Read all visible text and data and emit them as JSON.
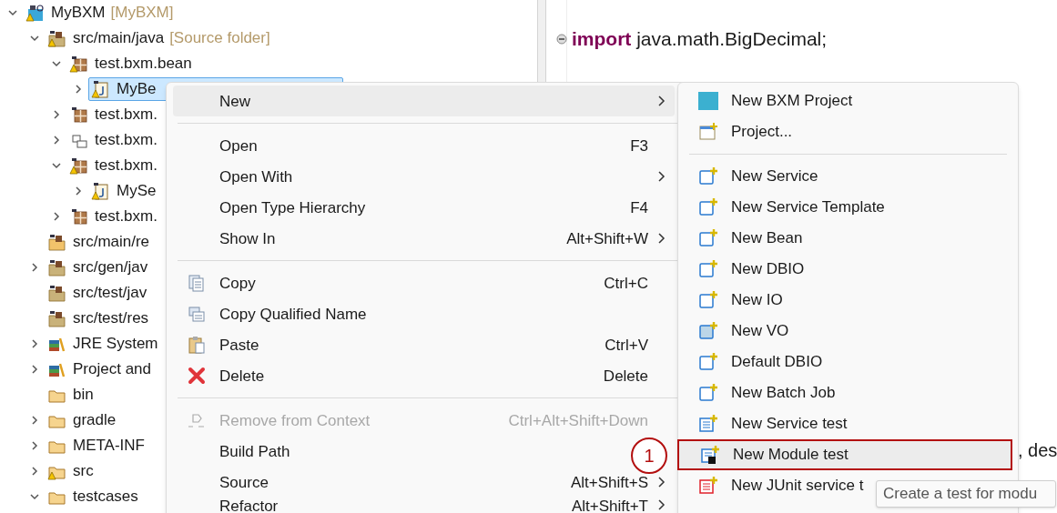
{
  "project_tree": {
    "items": [
      {
        "label": "MyBXM",
        "suffix": "[MyBXM]",
        "kind": "project",
        "warning": true,
        "expandable": true,
        "expanded": true,
        "selected": false,
        "children": [
          {
            "label": "src/main/java",
            "suffix": "[Source folder]",
            "kind": "source_folder",
            "warning": true,
            "expandable": true,
            "expanded": true,
            "selected": false,
            "children": [
              {
                "label": "test.bxm.bean",
                "kind": "package",
                "warning": true,
                "expandable": true,
                "expanded": true,
                "selected": false,
                "children": [
                  {
                    "label": "MyBe",
                    "kind": "file",
                    "warning": true,
                    "expandable": true,
                    "expanded": false,
                    "selected": true
                  }
                ]
              },
              {
                "label": "test.bxm.",
                "kind": "package",
                "warning": false,
                "expandable": true,
                "expanded": false,
                "selected": false
              },
              {
                "label": "test.bxm.",
                "kind": "package_empty",
                "warning": false,
                "expandable": true,
                "expanded": false,
                "selected": false
              },
              {
                "label": "test.bxm.",
                "kind": "package",
                "warning": true,
                "expandable": true,
                "expanded": true,
                "selected": false,
                "children": [
                  {
                    "label": "MySe",
                    "kind": "file",
                    "warning": true,
                    "expandable": true,
                    "expanded": false,
                    "selected": false
                  }
                ]
              },
              {
                "label": "test.bxm.",
                "kind": "package",
                "warning": false,
                "expandable": true,
                "expanded": false,
                "selected": false
              }
            ]
          },
          {
            "label": "src/main/re",
            "kind": "resource_folder",
            "warning": false,
            "expandable": false,
            "selected": false
          },
          {
            "label": "src/gen/jav",
            "kind": "source_folder",
            "warning": false,
            "expandable": true,
            "expanded": false,
            "selected": false
          },
          {
            "label": "src/test/jav",
            "kind": "source_folder",
            "warning": false,
            "expandable": false,
            "selected": false
          },
          {
            "label": "src/test/res",
            "kind": "source_folder",
            "warning": false,
            "expandable": false,
            "selected": false
          },
          {
            "label": "JRE System",
            "kind": "library",
            "warning": false,
            "expandable": true,
            "expanded": false,
            "selected": false
          },
          {
            "label": "Project and",
            "kind": "library",
            "warning": false,
            "expandable": true,
            "expanded": false,
            "selected": false
          },
          {
            "label": "bin",
            "kind": "folder",
            "warning": false,
            "expandable": false,
            "selected": false
          },
          {
            "label": "gradle",
            "kind": "folder",
            "warning": false,
            "expandable": true,
            "expanded": false,
            "selected": false
          },
          {
            "label": "META-INF",
            "kind": "folder",
            "warning": false,
            "expandable": true,
            "expanded": false,
            "selected": false
          },
          {
            "label": "src",
            "kind": "folder",
            "warning": true,
            "expandable": true,
            "expanded": false,
            "selected": false
          },
          {
            "label": "testcases",
            "kind": "folder",
            "warning": false,
            "expandable": true,
            "expanded": true,
            "selected": false
          }
        ]
      }
    ]
  },
  "editor": {
    "lines": [
      {
        "keyword": "import",
        "text": "java.math.BigDecimal;"
      }
    ],
    "fragment": ", des"
  },
  "context_menu": {
    "items": [
      {
        "kind": "item",
        "label": "New",
        "submenu": true,
        "disabled": false,
        "active": true
      },
      {
        "kind": "separator"
      },
      {
        "kind": "item",
        "label": "Open",
        "shortcut": "F3",
        "submenu": false,
        "disabled": false,
        "active": false
      },
      {
        "kind": "item",
        "label": "Open With",
        "submenu": true,
        "disabled": false,
        "active": false
      },
      {
        "kind": "item",
        "label": "Open Type Hierarchy",
        "shortcut": "F4",
        "submenu": false,
        "disabled": false,
        "active": false
      },
      {
        "kind": "item",
        "label": "Show In",
        "shortcut": "Alt+Shift+W",
        "submenu": true,
        "disabled": false,
        "active": false
      },
      {
        "kind": "separator"
      },
      {
        "kind": "item",
        "label": "Copy",
        "shortcut": "Ctrl+C",
        "submenu": false,
        "disabled": false,
        "active": false
      },
      {
        "kind": "item",
        "label": "Copy Qualified Name",
        "submenu": false,
        "disabled": false,
        "active": false
      },
      {
        "kind": "item",
        "label": "Paste",
        "shortcut": "Ctrl+V",
        "submenu": false,
        "disabled": false,
        "active": false
      },
      {
        "kind": "item",
        "label": "Delete",
        "shortcut": "Delete",
        "submenu": false,
        "disabled": false,
        "active": false
      },
      {
        "kind": "separator"
      },
      {
        "kind": "item",
        "label": "Remove from Context",
        "shortcut": "Ctrl+Alt+Shift+Down",
        "submenu": false,
        "disabled": true,
        "active": false
      },
      {
        "kind": "item",
        "label": "Build Path",
        "submenu": false,
        "disabled": false,
        "active": false
      },
      {
        "kind": "item",
        "label": "Source",
        "shortcut": "Alt+Shift+S",
        "submenu": true,
        "disabled": false,
        "active": false
      },
      {
        "kind": "item",
        "label": "Refactor",
        "shortcut": "Alt+Shift+T",
        "submenu": true,
        "disabled": false,
        "active": false
      }
    ]
  },
  "submenu": {
    "items": [
      {
        "kind": "item",
        "label": "New BXM Project",
        "active": false,
        "outlined": false
      },
      {
        "kind": "item",
        "label": "Project...",
        "active": false,
        "outlined": false
      },
      {
        "kind": "separator"
      },
      {
        "kind": "item",
        "label": "New Service",
        "active": false,
        "outlined": false
      },
      {
        "kind": "item",
        "label": "New Service Template",
        "active": false,
        "outlined": false
      },
      {
        "kind": "item",
        "label": "New Bean",
        "active": false,
        "outlined": false
      },
      {
        "kind": "item",
        "label": "New DBIO",
        "active": false,
        "outlined": false
      },
      {
        "kind": "item",
        "label": "New IO",
        "active": false,
        "outlined": false
      },
      {
        "kind": "item",
        "label": "New VO",
        "active": false,
        "outlined": false
      },
      {
        "kind": "item",
        "label": "Default DBIO",
        "active": false,
        "outlined": false
      },
      {
        "kind": "item",
        "label": "New Batch Job",
        "active": false,
        "outlined": false
      },
      {
        "kind": "item",
        "label": "New Service test",
        "active": false,
        "outlined": false
      },
      {
        "kind": "item",
        "label": "New Module test",
        "active": true,
        "outlined": true
      },
      {
        "kind": "item",
        "label": "New JUnit service t",
        "active": false,
        "outlined": false
      }
    ]
  },
  "annotation": {
    "label": "1"
  },
  "tooltip": {
    "text": "Create a test for modu"
  }
}
